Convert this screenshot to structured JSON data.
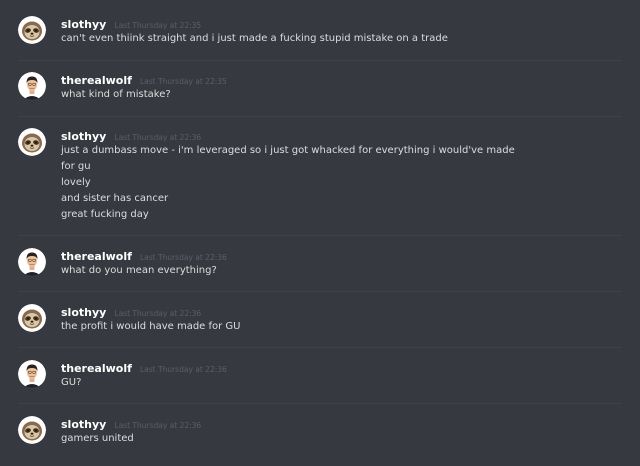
{
  "messages": [
    {
      "author": "slothyy",
      "timestamp": "Last Thursday at 22:35",
      "avatar": "sloth-avatar-icon",
      "lines": [
        "can't even thiink straight and i just made a fucking stupid mistake on a trade"
      ]
    },
    {
      "author": "therealwolf",
      "timestamp": "Last Thursday at 22:35",
      "avatar": "man-avatar-icon",
      "lines": [
        "what kind of mistake?"
      ]
    },
    {
      "author": "slothyy",
      "timestamp": "Last Thursday at 22:36",
      "avatar": "sloth-avatar-icon",
      "lines": [
        "just a dumbass move - i'm leveraged so i just got whacked for everything i would've made",
        "for gu",
        "lovely",
        "and sister has cancer",
        "great fucking day"
      ]
    },
    {
      "author": "therealwolf",
      "timestamp": "Last Thursday at 22:36",
      "avatar": "man-avatar-icon",
      "lines": [
        "what do you mean everything?"
      ]
    },
    {
      "author": "slothyy",
      "timestamp": "Last Thursday at 22:36",
      "avatar": "sloth-avatar-icon",
      "lines": [
        "the profit i would have made for GU"
      ]
    },
    {
      "author": "therealwolf",
      "timestamp": "Last Thursday at 22:36",
      "avatar": "man-avatar-icon",
      "lines": [
        "GU?"
      ]
    },
    {
      "author": "slothyy",
      "timestamp": "Last Thursday at 22:36",
      "avatar": "sloth-avatar-icon",
      "lines": [
        "gamers united"
      ]
    }
  ],
  "colors": {
    "background": "#36393f",
    "username": "#ffffff",
    "timestamp": "#5c5f66",
    "message_text": "#dcddde",
    "divider": "#3f4248"
  }
}
